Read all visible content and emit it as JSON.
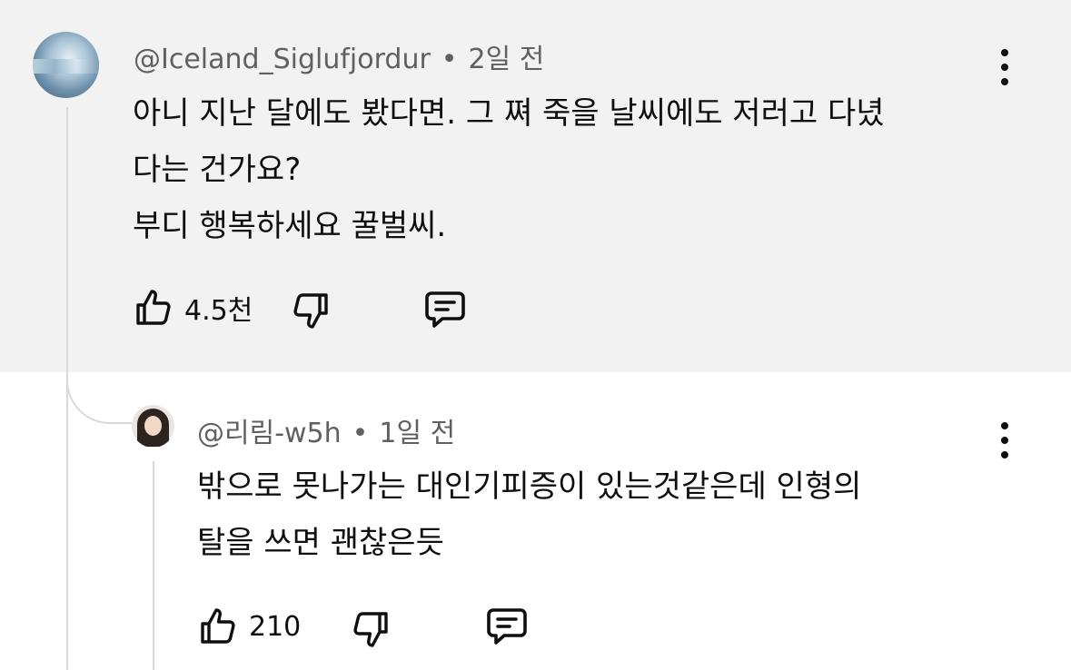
{
  "comment": {
    "author": "@Iceland_Siglufjordur",
    "separator": "•",
    "time": "2일 전",
    "lines": [
      "아니 지난 달에도 봤다면. 그 쪄 죽을 날씨에도 저러고 다녔",
      "다는 건가요?",
      "부디 행복하세요 꿀벌씨."
    ],
    "likes": "4.5천",
    "icons": {
      "like": "thumbs-up-icon",
      "dislike": "thumbs-down-icon",
      "reply": "comment-icon",
      "more": "more-vert-icon"
    }
  },
  "reply": {
    "author": "@리림-w5h",
    "separator": "•",
    "time": "1일 전",
    "lines": [
      "밖으로 못나가는 대인기피증이 있는것같은데 인형의",
      "탈을 쓰면 괜찮은듯"
    ],
    "likes": "210"
  }
}
